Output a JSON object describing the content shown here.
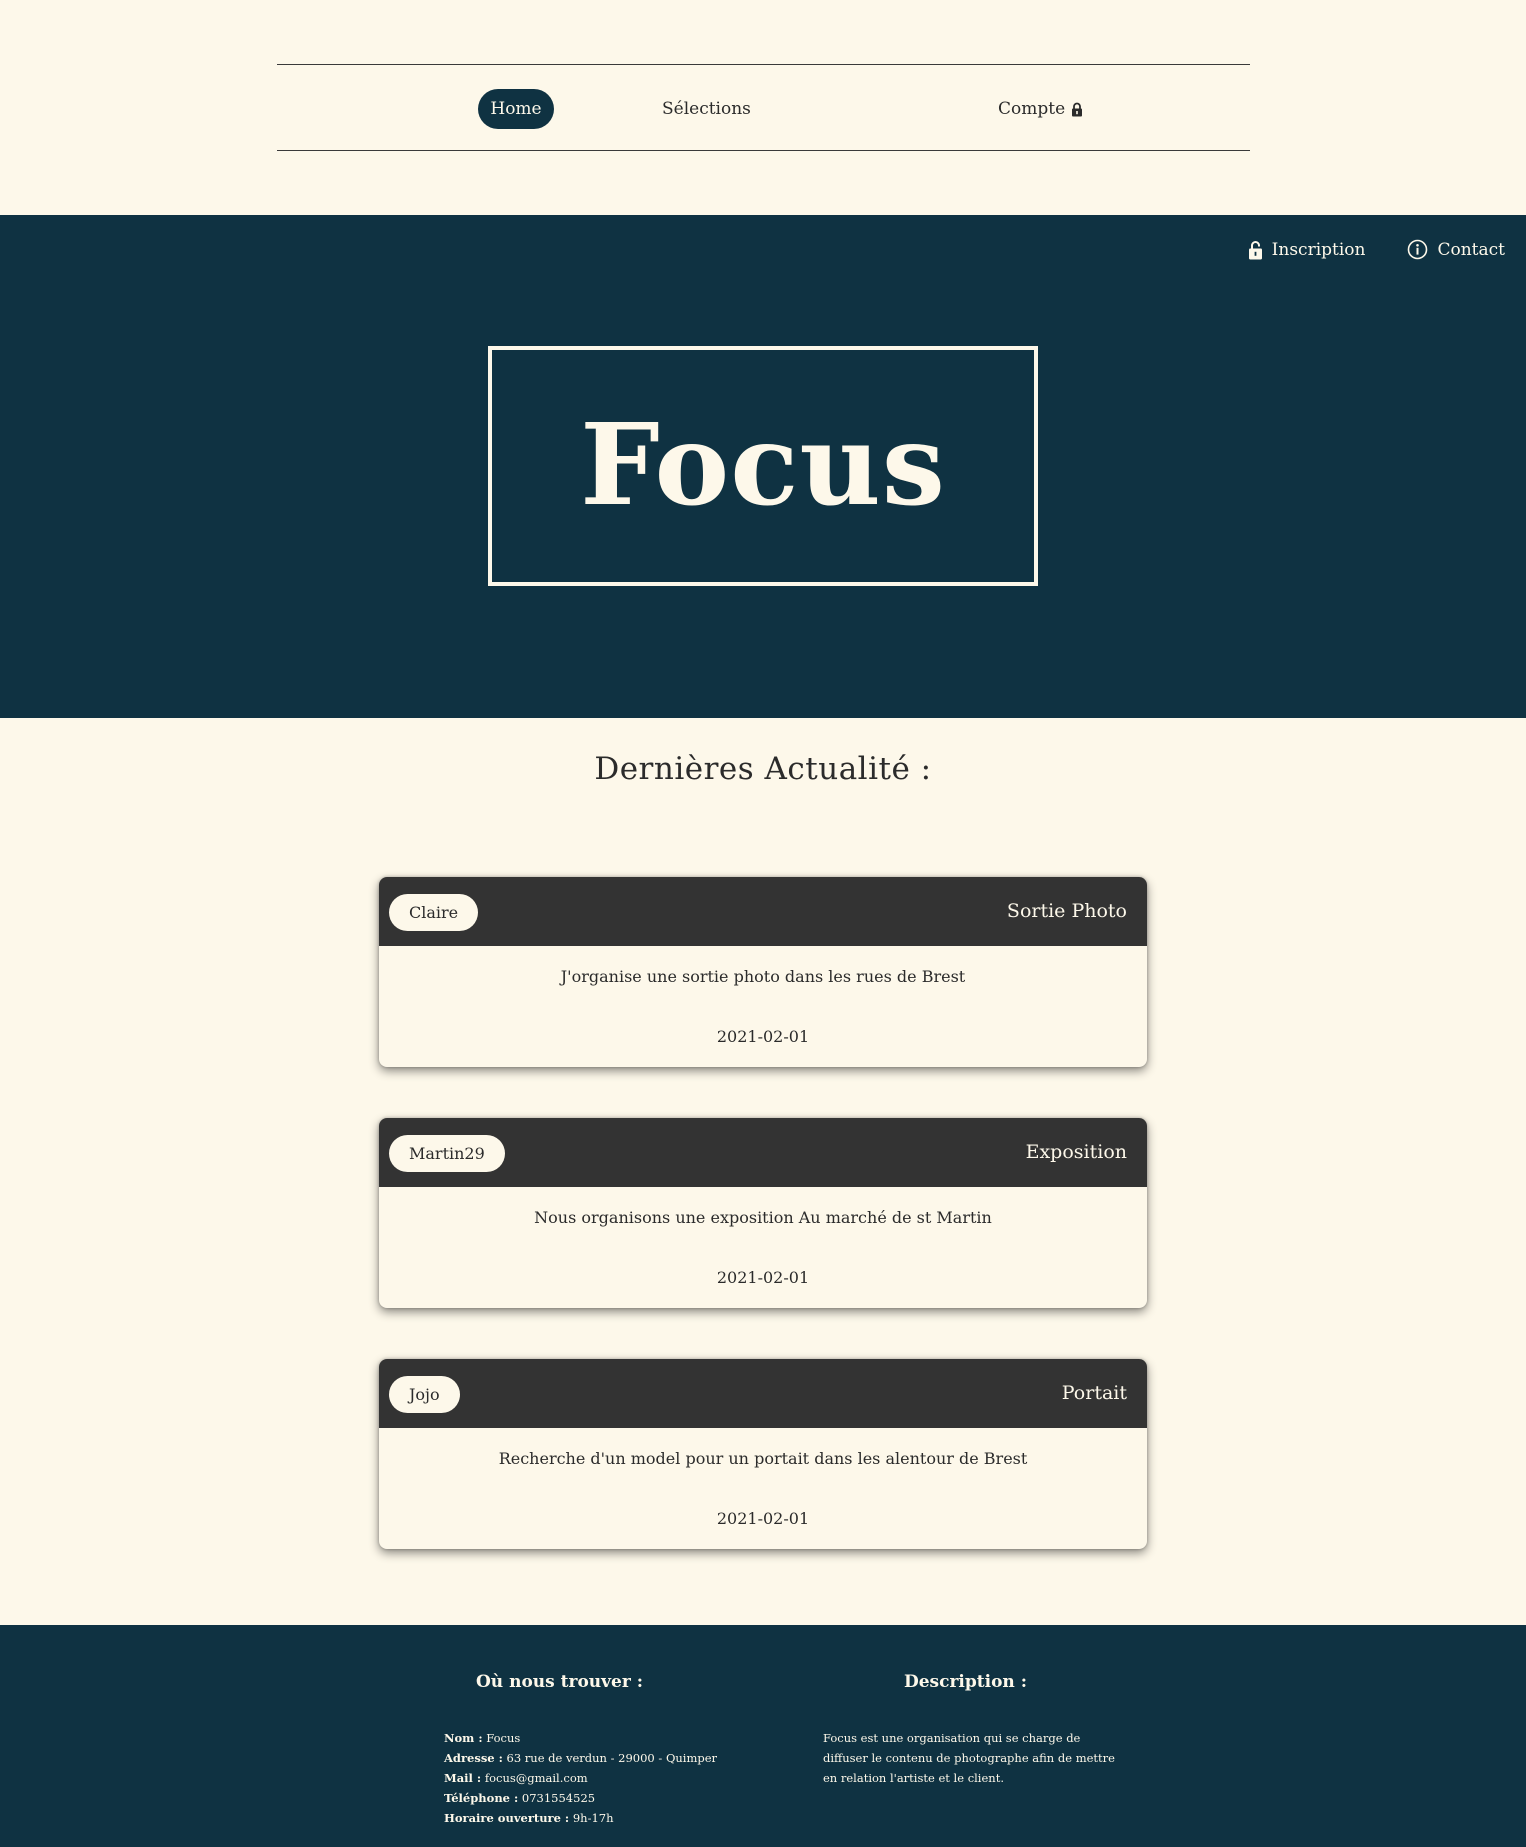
{
  "nav": {
    "home": "Home",
    "selections": "Sélections",
    "account": "Compte"
  },
  "hero": {
    "links": {
      "inscription": "Inscription",
      "contact": "Contact"
    },
    "brand": "Focus",
    "color": "#0f3242"
  },
  "news": {
    "title": "Dernières Actualité :",
    "items": [
      {
        "author": "Claire",
        "category": "Sortie Photo",
        "text": "J'organise une sortie photo dans les rues de Brest",
        "date": "2021-02-01"
      },
      {
        "author": "Martin29",
        "category": "Exposition",
        "text": "Nous organisons une exposition Au marché de st Martin",
        "date": "2021-02-01"
      },
      {
        "author": "Jojo",
        "category": "Portait",
        "text": "Recherche d'un model pour un portait dans les alentour de Brest",
        "date": "2021-02-01"
      }
    ]
  },
  "footer": {
    "where_title": "Où nous trouver :",
    "desc_title": "Description :",
    "contact": [
      {
        "label": "Nom :",
        "value": "Focus"
      },
      {
        "label": "Adresse :",
        "value": "63 rue de verdun - 29000 - Quimper"
      },
      {
        "label": "Mail :",
        "value": "focus@gmail.com"
      },
      {
        "label": "Téléphone :",
        "value": "0731554525"
      },
      {
        "label": "Horaire ouverture :",
        "value": "9h-17h"
      }
    ],
    "description": "Focus est une organisation qui se charge de diffuser le contenu de photographe afin de mettre en relation l'artiste et le client."
  },
  "icons": {
    "account": "lock-icon",
    "inscription": "unlock-icon",
    "contact": "info-icon"
  },
  "colors": {
    "background": "#fdf8ea",
    "primary": "#0f3242",
    "card_header": "#333333"
  }
}
